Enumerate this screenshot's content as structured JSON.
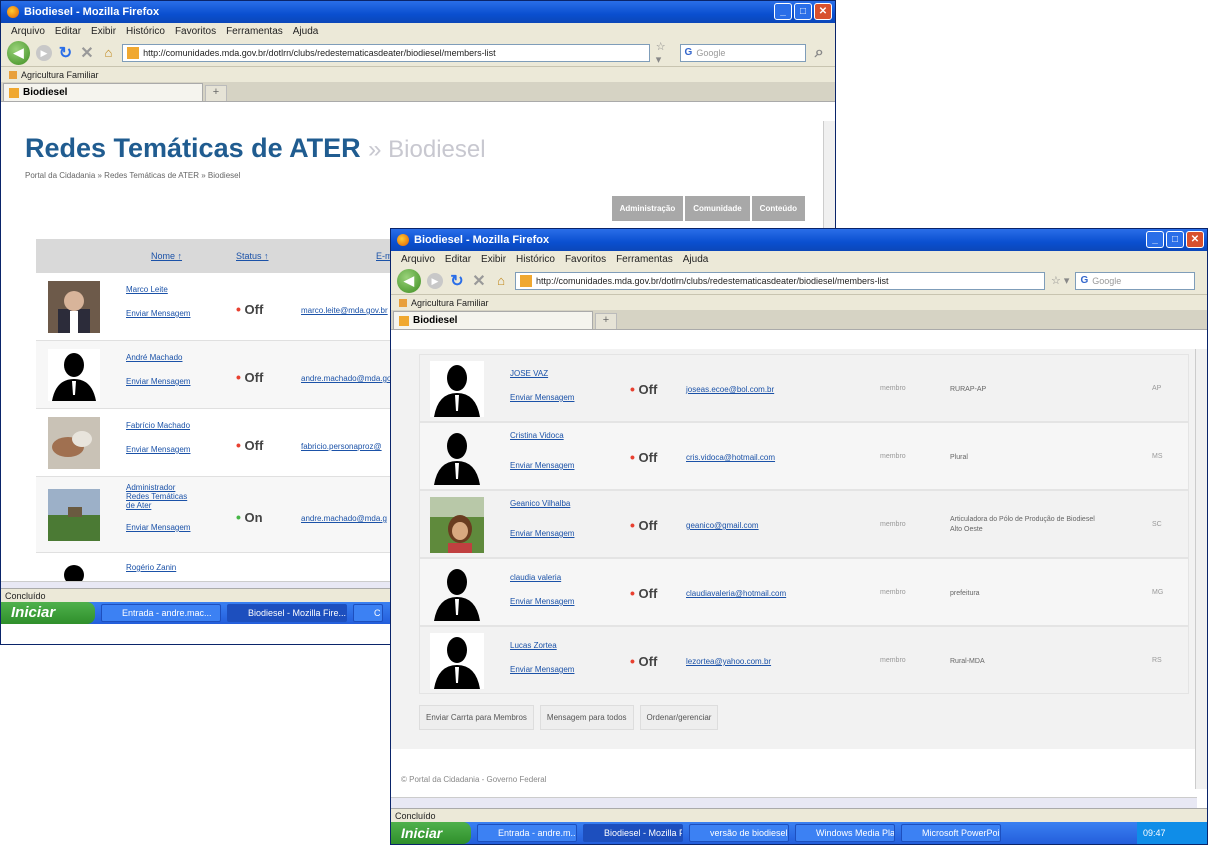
{
  "back_window": {
    "title": "Biodiesel - Mozilla Firefox",
    "menu": [
      "Arquivo",
      "Editar",
      "Exibir",
      "Histórico",
      "Favoritos",
      "Ferramentas",
      "Ajuda"
    ],
    "url": "http://comunidades.mda.gov.br/dotlrn/clubs/redestematicasdeater/biodiesel/members-list",
    "search_placeholder": "Google",
    "bookmark": "Agricultura Familiar",
    "tab": "Biodiesel",
    "page_title": "Redes Temáticas de ATER",
    "page_subtitle": "» Biodiesel",
    "breadcrumb": "Portal da Cidadania » Redes Temáticas de ATER » Biodiesel",
    "buttons": [
      "Administração",
      "Comunidade",
      "Conteúdo"
    ],
    "columns": [
      "Nome ↑",
      "Status ↑",
      "E-mail"
    ],
    "rows": [
      {
        "name": "Marco Leite",
        "msg": "Enviar Mensagem",
        "status": "Off",
        "email": "marco.leite@mda.gov.br"
      },
      {
        "name": "André Machado",
        "msg": "Enviar Mensagem",
        "status": "Off",
        "email": "andre.machado@mda.gov.br"
      },
      {
        "name": "Fabrício Machado",
        "msg": "Enviar Mensagem",
        "status": "Off",
        "email": "fabricio.personaproz@"
      },
      {
        "name": "Administrador Redes Temáticas de Ater",
        "msg": "Enviar Mensagem",
        "status": "On",
        "email": "andre.machado@mda.g"
      },
      {
        "name": "Rogério Zanin",
        "msg": "",
        "status": "",
        "email": ""
      }
    ],
    "status_text": "Concluído",
    "start": "Iniciar",
    "taskbar": [
      "Entrada - andre.mac...",
      "Biodiesel - Mozilla Fire...",
      "C"
    ]
  },
  "front_window": {
    "title": "Biodiesel - Mozilla Firefox",
    "menu": [
      "Arquivo",
      "Editar",
      "Exibir",
      "Histórico",
      "Favoritos",
      "Ferramentas",
      "Ajuda"
    ],
    "url": "http://comunidades.mda.gov.br/dotlrn/clubs/redestematicasdeater/biodiesel/members-list",
    "search_placeholder": "Google",
    "bookmark": "Agricultura Familiar",
    "tab": "Biodiesel",
    "rows": [
      {
        "name": "JOSE VAZ",
        "msg": "Enviar Mensagem",
        "status": "Off",
        "email": "joseas.ecoe@bol.com.br",
        "role": "membro",
        "org": "RURAP-AP",
        "uf": "AP"
      },
      {
        "name": "Cristina Vidoca",
        "msg": "Enviar Mensagem",
        "status": "Off",
        "email": "cris.vidoca@hotmail.com",
        "role": "membro",
        "org": "Plural",
        "uf": "MS"
      },
      {
        "name": "Geanico Vilhalba",
        "msg": "Enviar Mensagem",
        "status": "Off",
        "email": "geanico@gmail.com",
        "role": "membro",
        "org": "Articuladora do Pólo de Produção de Biodiesel Alto Oeste",
        "uf": "SC"
      },
      {
        "name": "claudia valeria",
        "msg": "Enviar Mensagem",
        "status": "Off",
        "email": "claudiavaleria@hotmail.com",
        "role": "membro",
        "org": "prefeitura",
        "uf": "MG"
      },
      {
        "name": "Lucas Zortea",
        "msg": "Enviar Mensagem",
        "status": "Off",
        "email": "lezortea@yahoo.com.br",
        "role": "membro",
        "org": "Rural-MDA",
        "uf": "RS"
      }
    ],
    "buttons": [
      "Enviar Carrta para Membros",
      "Mensagem para todos",
      "Ordenar/gerenciar"
    ],
    "footer": "© Portal da Cidadania - Governo Federal",
    "status_text": "Concluído",
    "start": "Iniciar",
    "taskbar": [
      "Entrada - andre.m...",
      "Biodiesel - Mozilla F...",
      "versão de biodiesel",
      "Windows Media Pla...",
      "Microsoft PowerPoi..."
    ],
    "clock": "09:47"
  }
}
